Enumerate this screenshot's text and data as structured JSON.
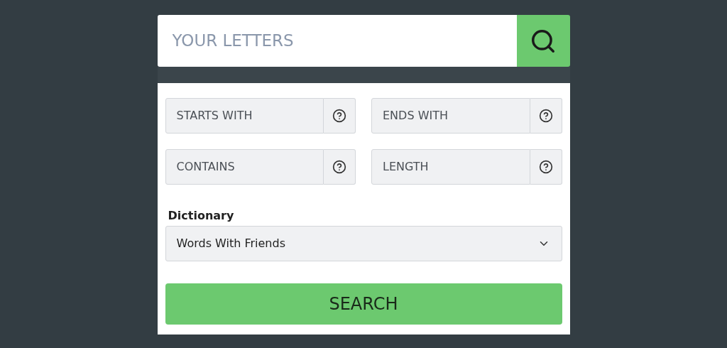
{
  "search": {
    "placeholder": "YOUR LETTERS"
  },
  "filters": [
    {
      "placeholder": "STARTS WITH"
    },
    {
      "placeholder": "ENDS WITH"
    },
    {
      "placeholder": "CONTAINS"
    },
    {
      "placeholder": "LENGTH"
    }
  ],
  "dictionary": {
    "label": "Dictionary",
    "value": "Words With Friends"
  },
  "submit": "SEARCH"
}
